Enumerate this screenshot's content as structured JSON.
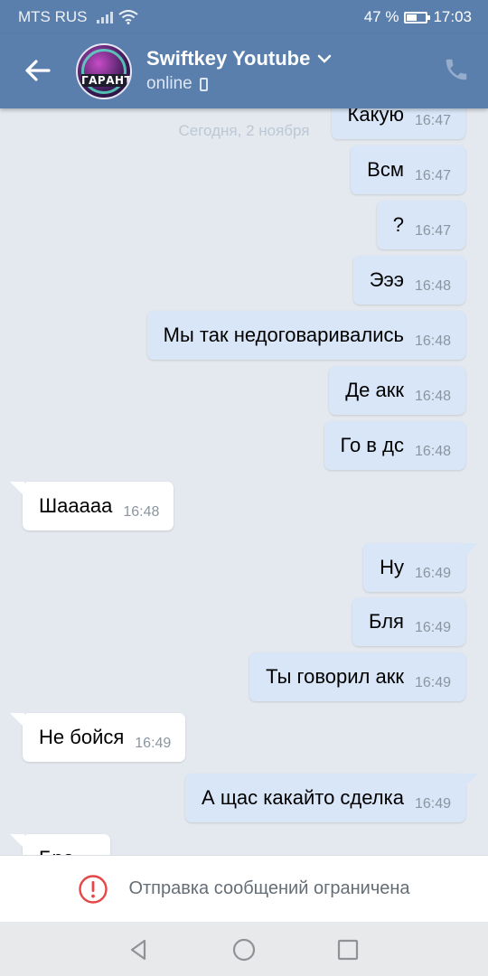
{
  "status_bar": {
    "carrier": "MTS RUS",
    "battery": "47 %",
    "battery_level": 0.47,
    "time": "17:03"
  },
  "header": {
    "contact_name": "Swiftkey Youtube",
    "status": "online",
    "avatar_text": "ГАРАНТ",
    "icons": [
      "back-arrow-icon",
      "chevron-down-icon",
      "mobile-phone-icon",
      "phone-call-icon"
    ]
  },
  "chat": {
    "date_separator": "Сегодня, 2 ноября",
    "messages": [
      {
        "dir": "out",
        "text": "Какую",
        "time": "16:47"
      },
      {
        "dir": "out",
        "text": "Всм",
        "time": "16:47"
      },
      {
        "dir": "out",
        "text": "?",
        "time": "16:47"
      },
      {
        "dir": "out",
        "text": "Эээ",
        "time": "16:48"
      },
      {
        "dir": "out",
        "text": "Мы так недоговаривались",
        "time": "16:48"
      },
      {
        "dir": "out",
        "text": "Де акк",
        "time": "16:48"
      },
      {
        "dir": "out",
        "text": "Го в дс",
        "time": "16:48"
      },
      {
        "dir": "in",
        "text": "Шааааа",
        "time": "16:48"
      },
      {
        "dir": "out",
        "text": "Ну",
        "time": "16:49"
      },
      {
        "dir": "out",
        "text": "Бля",
        "time": "16:49"
      },
      {
        "dir": "out",
        "text": "Ты говорил акк",
        "time": "16:49"
      },
      {
        "dir": "in",
        "text": "Не бойся",
        "time": "16:49"
      },
      {
        "dir": "out",
        "text": "А щас какайто сделка",
        "time": "16:49"
      },
      {
        "dir": "in",
        "text": "Бро",
        "time": ""
      }
    ]
  },
  "banner": {
    "text": "Отправка сообщений ограничена",
    "icon": "warning-circle-icon",
    "accent": "#e64646"
  },
  "navbar": {
    "icons": [
      "back-triangle-icon",
      "home-circle-icon",
      "recents-square-icon"
    ]
  },
  "colors": {
    "header_bg": "#5b7fad",
    "chat_bg": "#e4e9ef",
    "outgoing_bubble": "#d8e6f8",
    "incoming_bubble": "#ffffff"
  }
}
